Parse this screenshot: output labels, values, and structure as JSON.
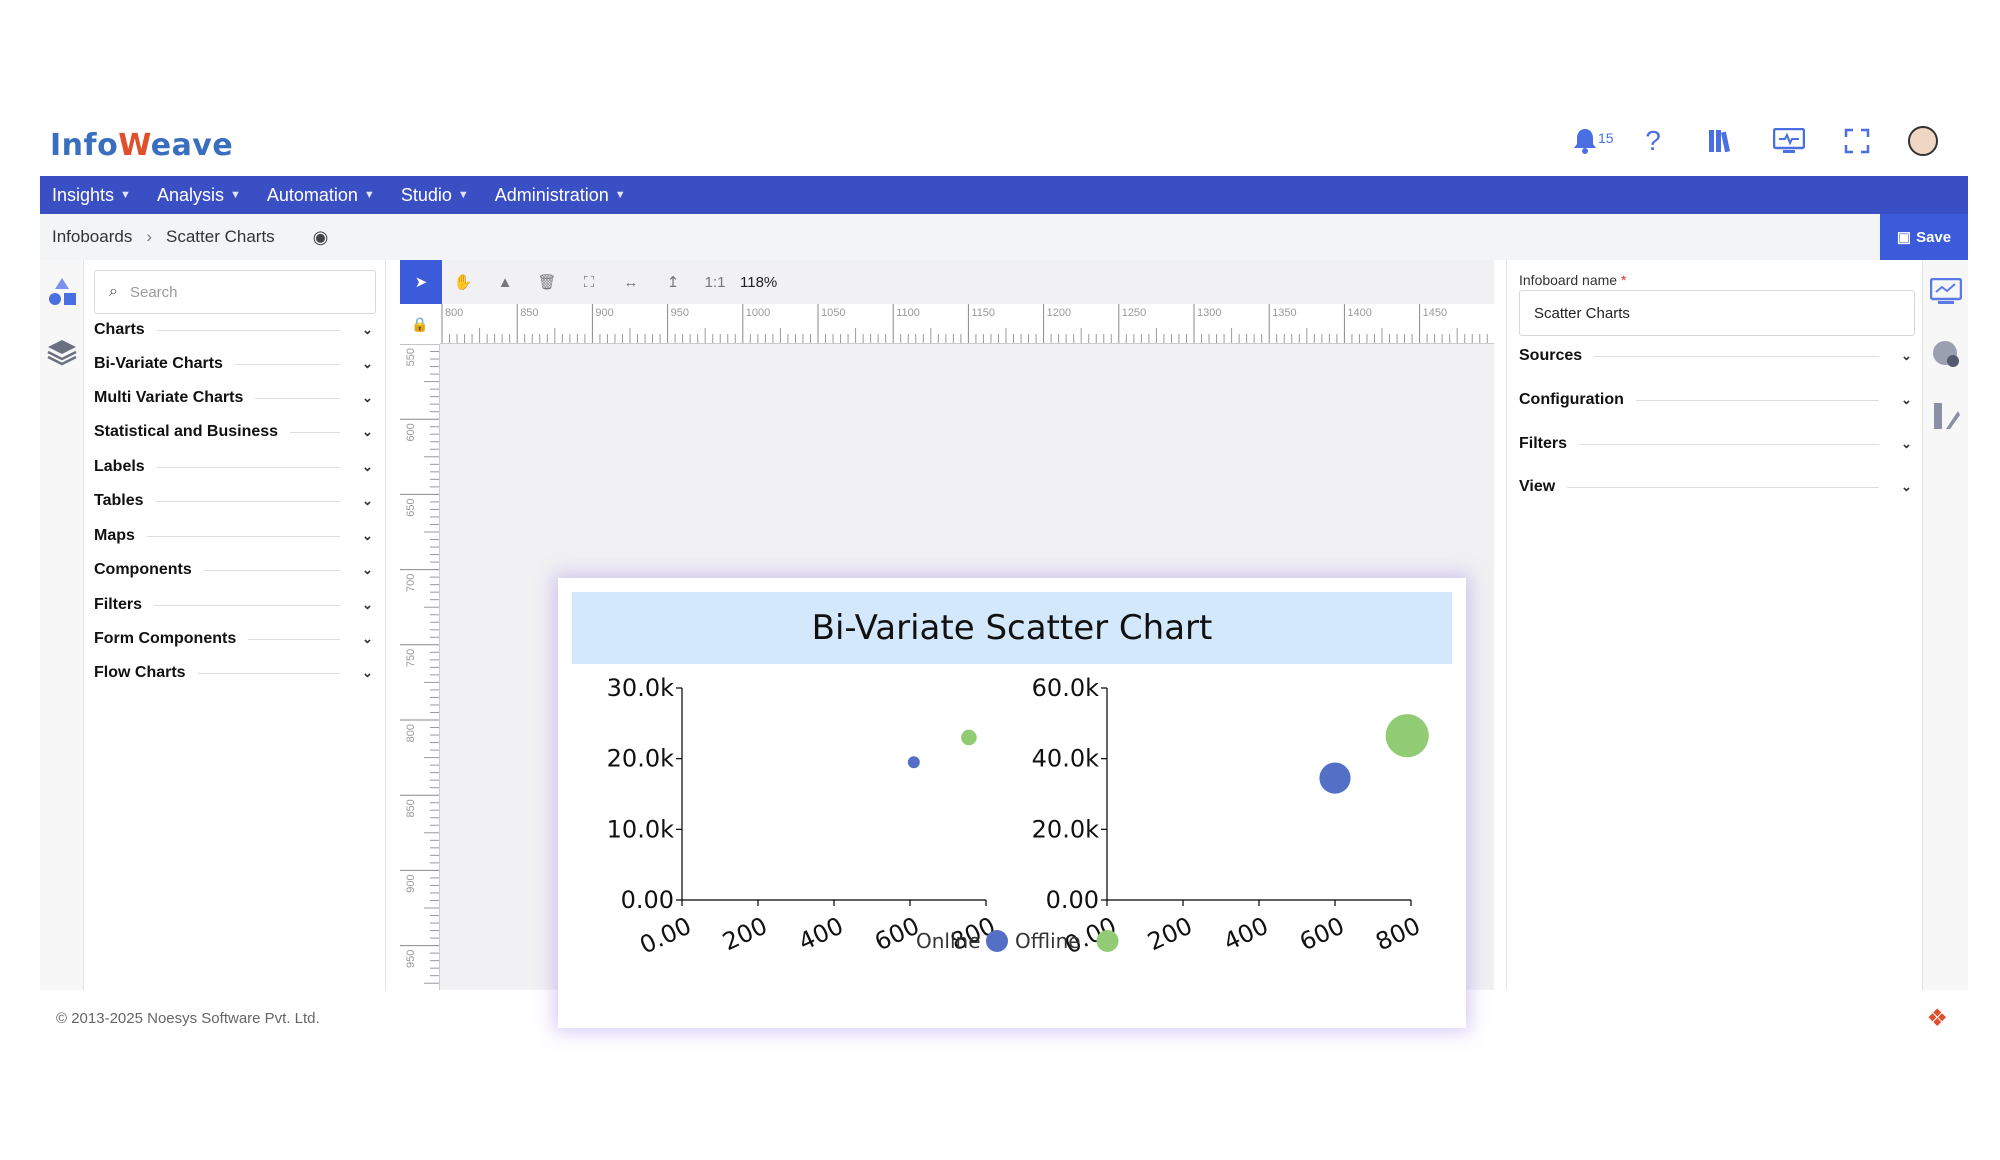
{
  "brand": {
    "logo_text_a": "Info",
    "logo_text_b": "eave",
    "logo_mark": "W"
  },
  "header": {
    "notifications_count": "15",
    "icons": [
      "bell-icon",
      "help-icon",
      "library-icon",
      "monitor-icon",
      "fullscreen-icon",
      "user-avatar"
    ]
  },
  "nav": [
    {
      "label": "Insights"
    },
    {
      "label": "Analysis"
    },
    {
      "label": "Automation"
    },
    {
      "label": "Studio"
    },
    {
      "label": "Administration"
    }
  ],
  "breadcrumb": {
    "root": "Infoboards",
    "current": "Scatter Charts"
  },
  "save_label": "Save",
  "search": {
    "placeholder": "Search"
  },
  "categories": [
    "Charts",
    "Bi-Variate Charts",
    "Multi Variate Charts",
    "Statistical and Business",
    "Labels",
    "Tables",
    "Maps",
    "Components",
    "Filters",
    "Form Components",
    "Flow Charts"
  ],
  "toolbar": {
    "zoom": "118%",
    "ratio": "1:1"
  },
  "ruler": {
    "top": [
      "800",
      "850",
      "900",
      "950",
      "1000",
      "1050",
      "1100",
      "1150",
      "1200",
      "1250",
      "1300",
      "1350",
      "1400",
      "1450"
    ],
    "left": [
      "550",
      "600",
      "650",
      "700",
      "750",
      "800",
      "850",
      "900",
      "950"
    ]
  },
  "properties": {
    "name_label": "Infoboard name",
    "required_mark": "*",
    "name_value": "Scatter Charts",
    "sections": [
      "Sources",
      "Configuration",
      "Filters",
      "View"
    ]
  },
  "footer": {
    "copyright": "© 2013-2025 Noesys Software Pvt. Ltd."
  },
  "chart_data": {
    "type": "scatter",
    "title": "Bi-Variate Scatter Chart",
    "legend": [
      {
        "name": "Online",
        "color": "#5470c6"
      },
      {
        "name": "Offline",
        "color": "#91cc75"
      }
    ],
    "panels": [
      {
        "xticks": [
          "0.00",
          "200",
          "400",
          "600",
          "800"
        ],
        "yticks": [
          "0.00",
          "10.0k",
          "20.0k",
          "30.0k"
        ],
        "xlim": [
          0,
          800
        ],
        "ylim": [
          0,
          30000
        ],
        "points": [
          {
            "series": "Online",
            "x": 610,
            "y": 19500,
            "size": 1
          },
          {
            "series": "Offline",
            "x": 755,
            "y": 23000,
            "size": 1.3
          }
        ]
      },
      {
        "xticks": [
          "0.00",
          "200",
          "400",
          "600",
          "800"
        ],
        "yticks": [
          "0.00",
          "20.0k",
          "40.0k",
          "60.0k"
        ],
        "xlim": [
          0,
          800
        ],
        "ylim": [
          0,
          60000
        ],
        "points": [
          {
            "series": "Online",
            "x": 600,
            "y": 34500,
            "size": 2.6
          },
          {
            "series": "Offline",
            "x": 790,
            "y": 46500,
            "size": 3.6
          }
        ]
      }
    ]
  }
}
